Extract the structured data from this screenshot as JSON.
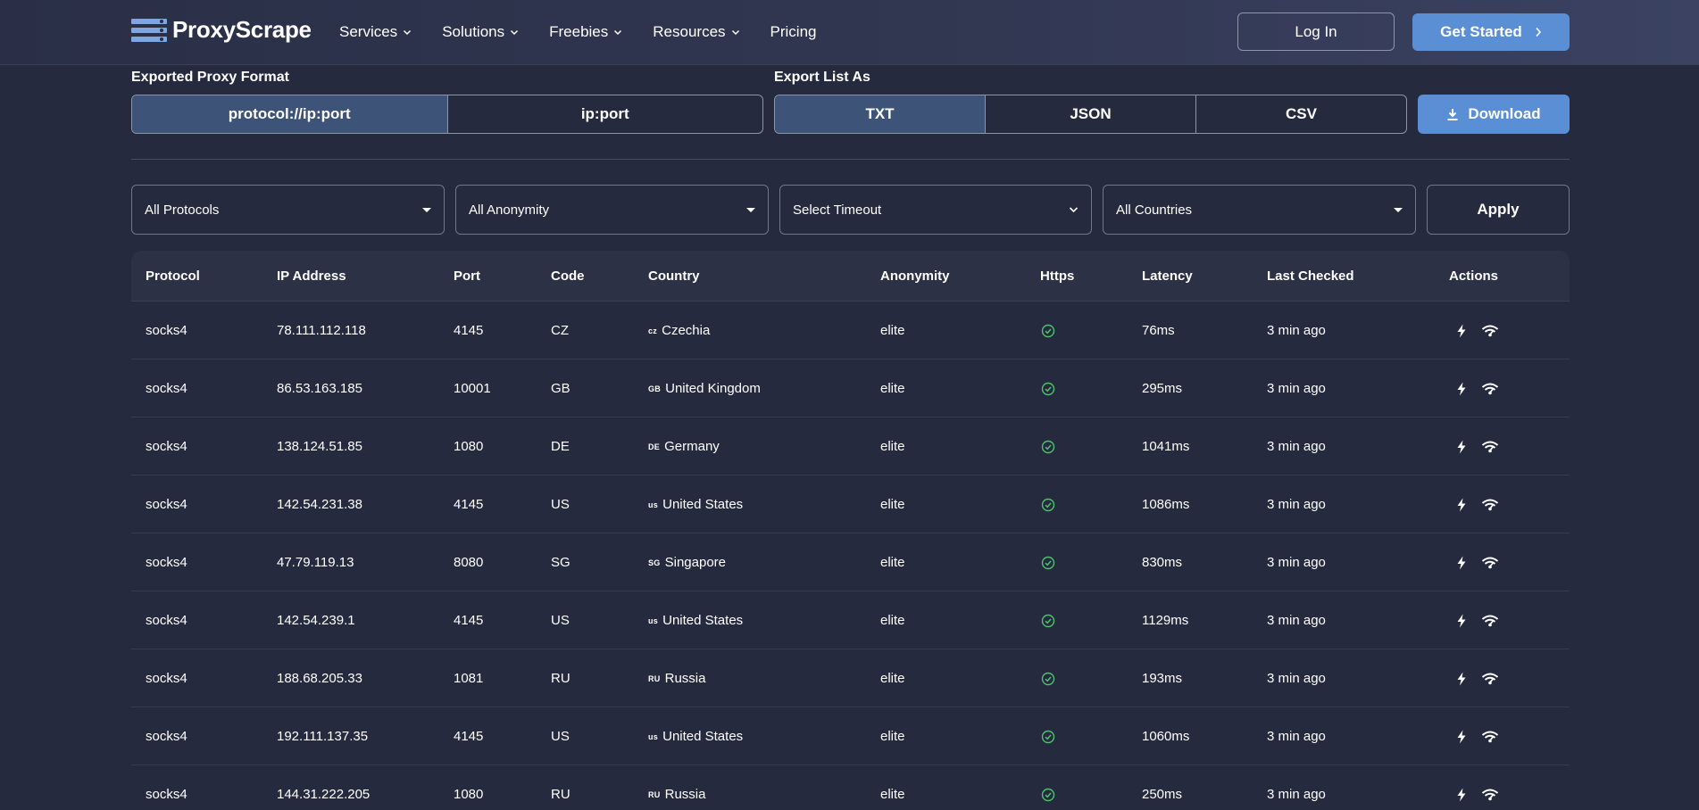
{
  "brand": {
    "name": "ProxyScrape"
  },
  "nav": {
    "items": [
      {
        "label": "Services",
        "dropdown": true
      },
      {
        "label": "Solutions",
        "dropdown": true
      },
      {
        "label": "Freebies",
        "dropdown": true
      },
      {
        "label": "Resources",
        "dropdown": true
      },
      {
        "label": "Pricing",
        "dropdown": false
      }
    ],
    "login": "Log In",
    "get_started": "Get Started"
  },
  "export": {
    "format_label": "Exported Proxy Format",
    "formats": [
      "protocol://ip:port",
      "ip:port"
    ],
    "selected_format": "protocol://ip:port",
    "list_label": "Export List As",
    "list_types": [
      "TXT",
      "JSON",
      "CSV"
    ],
    "selected_list_type": "TXT",
    "download": "Download"
  },
  "filters": {
    "protocol": "All Protocols",
    "anonymity": "All Anonymity",
    "timeout": "Select Timeout",
    "country": "All Countries",
    "apply": "Apply"
  },
  "table": {
    "headers": {
      "protocol": "Protocol",
      "ip": "IP Address",
      "port": "Port",
      "code": "Code",
      "country": "Country",
      "anonymity": "Anonymity",
      "https": "Https",
      "latency": "Latency",
      "last_checked": "Last Checked",
      "actions": "Actions"
    },
    "rows": [
      {
        "protocol": "socks4",
        "ip": "78.111.112.118",
        "port": "4145",
        "code": "CZ",
        "flag": "cz",
        "country": "Czechia",
        "anonymity": "elite",
        "https": true,
        "latency": "76ms",
        "last_checked": "3 min ago"
      },
      {
        "protocol": "socks4",
        "ip": "86.53.163.185",
        "port": "10001",
        "code": "GB",
        "flag": "GB",
        "country": "United Kingdom",
        "anonymity": "elite",
        "https": true,
        "latency": "295ms",
        "last_checked": "3 min ago"
      },
      {
        "protocol": "socks4",
        "ip": "138.124.51.85",
        "port": "1080",
        "code": "DE",
        "flag": "DE",
        "country": "Germany",
        "anonymity": "elite",
        "https": true,
        "latency": "1041ms",
        "last_checked": "3 min ago"
      },
      {
        "protocol": "socks4",
        "ip": "142.54.231.38",
        "port": "4145",
        "code": "US",
        "flag": "us",
        "country": "United States",
        "anonymity": "elite",
        "https": true,
        "latency": "1086ms",
        "last_checked": "3 min ago"
      },
      {
        "protocol": "socks4",
        "ip": "47.79.119.13",
        "port": "8080",
        "code": "SG",
        "flag": "SG",
        "country": "Singapore",
        "anonymity": "elite",
        "https": true,
        "latency": "830ms",
        "last_checked": "3 min ago"
      },
      {
        "protocol": "socks4",
        "ip": "142.54.239.1",
        "port": "4145",
        "code": "US",
        "flag": "us",
        "country": "United States",
        "anonymity": "elite",
        "https": true,
        "latency": "1129ms",
        "last_checked": "3 min ago"
      },
      {
        "protocol": "socks4",
        "ip": "188.68.205.33",
        "port": "1081",
        "code": "RU",
        "flag": "RU",
        "country": "Russia",
        "anonymity": "elite",
        "https": true,
        "latency": "193ms",
        "last_checked": "3 min ago"
      },
      {
        "protocol": "socks4",
        "ip": "192.111.137.35",
        "port": "4145",
        "code": "US",
        "flag": "us",
        "country": "United States",
        "anonymity": "elite",
        "https": true,
        "latency": "1060ms",
        "last_checked": "3 min ago"
      },
      {
        "protocol": "socks4",
        "ip": "144.31.222.205",
        "port": "1080",
        "code": "RU",
        "flag": "RU",
        "country": "Russia",
        "anonymity": "elite",
        "https": true,
        "latency": "250ms",
        "last_checked": "3 min ago"
      }
    ],
    "row_actions": [
      "bolt-icon",
      "wifi-icon"
    ]
  },
  "colors": {
    "background": "#262a3f",
    "accent": "#5a8fd6",
    "active_segment": "#3d5378",
    "check": "#4cc36a"
  }
}
